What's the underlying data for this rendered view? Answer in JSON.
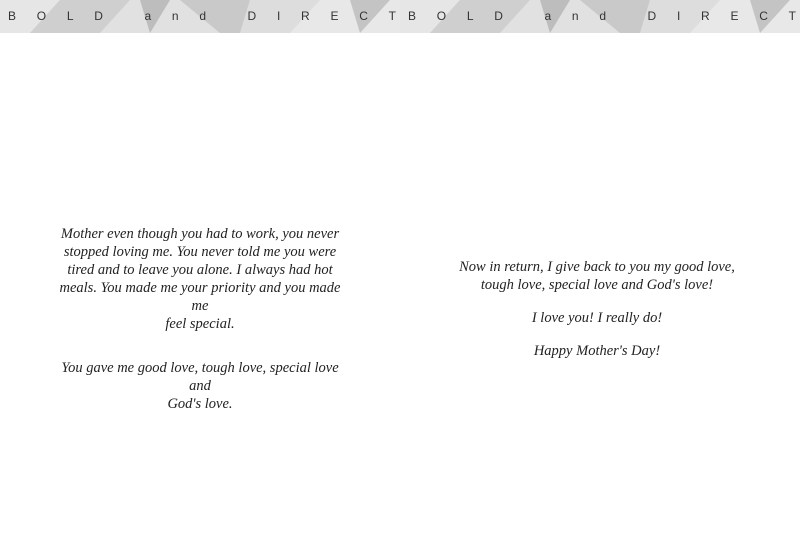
{
  "banner": {
    "left_letters": [
      "B",
      "O",
      "L",
      "D",
      "",
      "a",
      "n",
      "d",
      "",
      "D",
      "I",
      "R",
      "E",
      "C",
      "T"
    ],
    "right_letters": [
      "B",
      "O",
      "L",
      "D",
      "",
      "a",
      "n",
      "d",
      "",
      "D",
      "I",
      "R",
      "E",
      "C",
      "T"
    ]
  },
  "left_panel": {
    "paragraph1": "Mother even though you had to work, you never\nstopped loving me.  You never told me you were\ntired and to leave you alone.  I always had hot\nmeals.  You made me your priority and you made me\nfeel special.",
    "paragraph2": "You gave me good love, tough love, special love and\nGod's love."
  },
  "right_panel": {
    "paragraph1": "Now in return, I give back to you my good love,\ntough love, special love and God's love!",
    "paragraph2": "I love you!  I really do!",
    "paragraph3": "Happy Mother's Day!"
  },
  "colors": {
    "banner_base": "#d9d9d9",
    "text": "#222222"
  }
}
